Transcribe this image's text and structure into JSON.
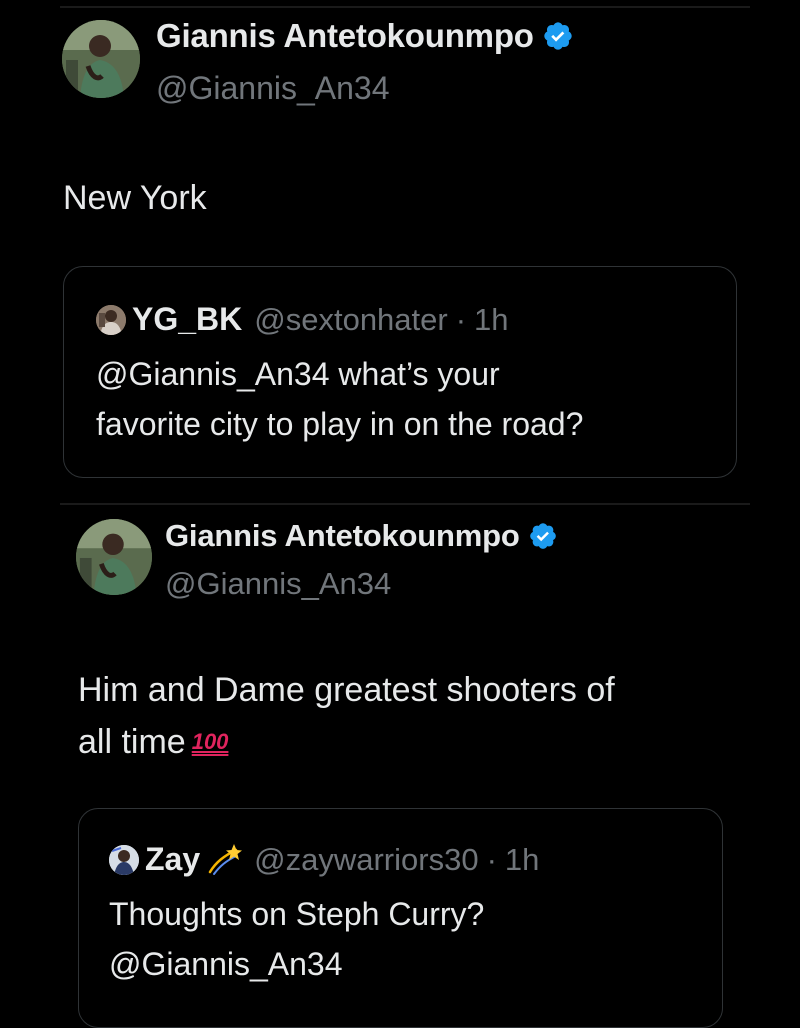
{
  "tweets": [
    {
      "author": {
        "display_name": "Giannis Antetokounmpo",
        "handle": "@Giannis_An34",
        "verified": true,
        "avatar_icon": "person-avatar"
      },
      "text": "New York",
      "quote": {
        "author_name": "YG_BK",
        "author_handle": "@sextonhater",
        "separator": "·",
        "time": "1h",
        "text_line1": "@Giannis_An34 what’s your",
        "text_line2": "favorite city to play in on the road?"
      }
    },
    {
      "author": {
        "display_name": "Giannis Antetokounmpo",
        "handle": "@Giannis_An34",
        "verified": true,
        "avatar_icon": "person-avatar"
      },
      "text_line1": "Him and Dame greatest shooters of",
      "text_line2": "all time",
      "emoji": "100",
      "quote": {
        "author_name": "Zay",
        "author_emoji_icon": "dizzy-icon",
        "author_handle": "@zaywarriors30",
        "separator": "·",
        "time": "1h",
        "text_line1": "Thoughts on Steph Curry?",
        "text_line2": "@Giannis_An34"
      }
    }
  ],
  "colors": {
    "background": "#000000",
    "text_primary": "#e7e9ea",
    "text_secondary": "#71767b",
    "border": "#2f3336",
    "verified_blue": "#1d9bf0",
    "emoji_red": "#e0245e"
  }
}
